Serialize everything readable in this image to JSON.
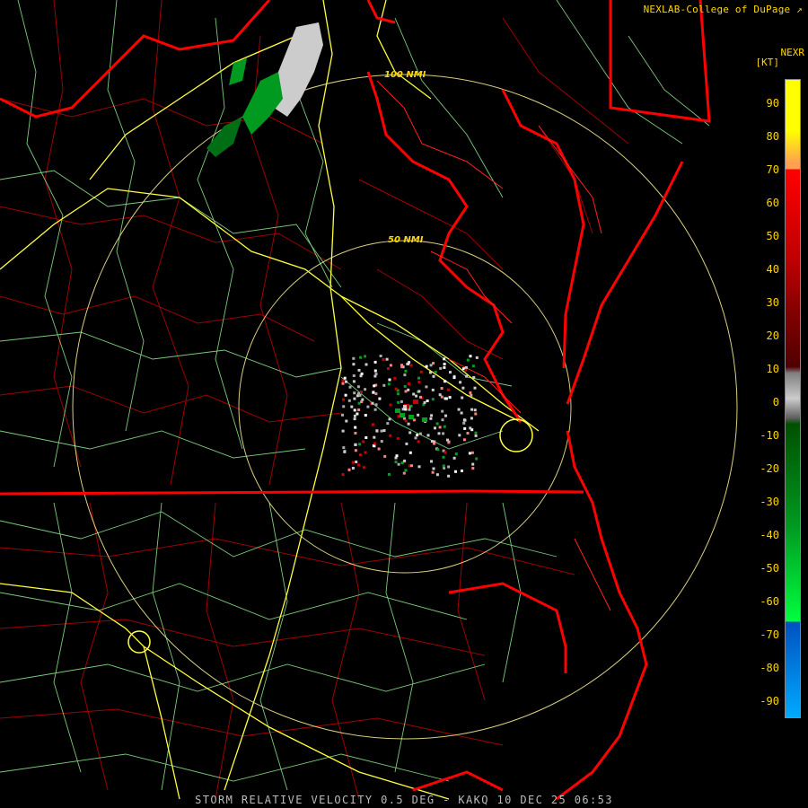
{
  "header": {
    "credit": "NEXLAB-College of DuPage"
  },
  "legend": {
    "product": "NEXR",
    "unit": "[KT]",
    "ticks": [
      "90",
      "80",
      "70",
      "60",
      "50",
      "40",
      "30",
      "20",
      "10",
      "0",
      "-10",
      "-20",
      "-30",
      "-40",
      "-50",
      "-60",
      "-70",
      "-80",
      "-90"
    ],
    "colors": {
      "high": "#ffff00",
      "orange": "#ffa050",
      "red": "#ff0000",
      "darkred": "#500000",
      "gray": "#cccccc",
      "darkgreen": "#005000",
      "green": "#00ff40",
      "blue": "#0050c0",
      "lightblue": "#00aaff"
    }
  },
  "rings": [
    {
      "label": "100 NMI",
      "range_nmi": 100
    },
    {
      "label": "50 NMI",
      "range_nmi": 50
    }
  ],
  "footer": {
    "caption": "STORM RELATIVE VELOCITY 0.5 DEG - KAKQ 10 DEC 25 06:53"
  },
  "map_colors": {
    "coast": "#ff0000",
    "county": "#a00000",
    "road_minor": "#90ee90",
    "highway": "#ffff40",
    "ring": "#f0e68c"
  }
}
